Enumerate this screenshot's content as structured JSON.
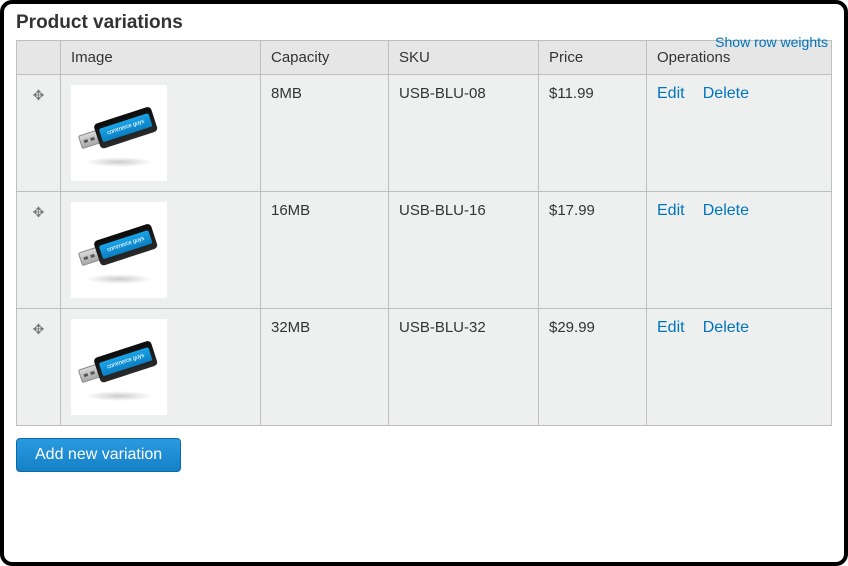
{
  "section_title": "Product variations",
  "show_row_weights": "Show row weights",
  "columns": {
    "image": "Image",
    "capacity": "Capacity",
    "sku": "SKU",
    "price": "Price",
    "operations": "Operations"
  },
  "ops": {
    "edit": "Edit",
    "delete": "Delete"
  },
  "rows": [
    {
      "capacity": "8MB",
      "sku": "USB-BLU-08",
      "price": "$11.99"
    },
    {
      "capacity": "16MB",
      "sku": "USB-BLU-16",
      "price": "$17.99"
    },
    {
      "capacity": "32MB",
      "sku": "USB-BLU-32",
      "price": "$29.99"
    }
  ],
  "add_button": "Add new variation",
  "thumb_caption": "commerce guys",
  "colors": {
    "link": "#0074bd"
  }
}
